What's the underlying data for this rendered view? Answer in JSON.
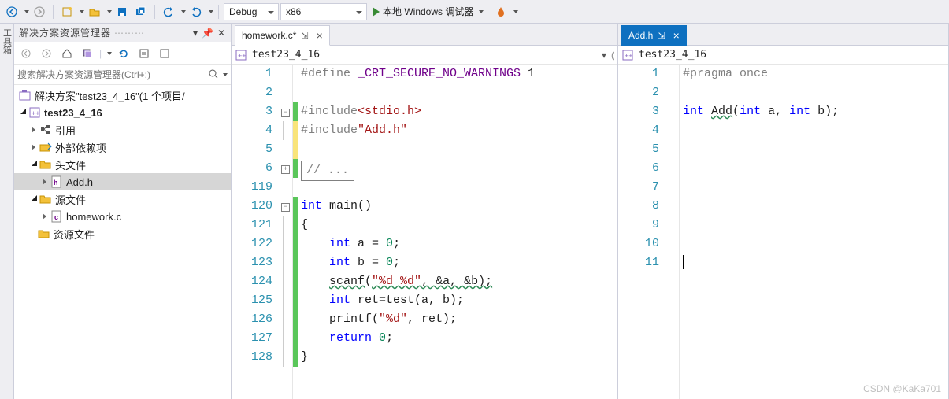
{
  "toolbar": {
    "config_label": "Debug",
    "platform_label": "x86",
    "run_label": "本地 Windows 调试器"
  },
  "solution_explorer": {
    "title": "解决方案资源管理器",
    "search_placeholder": "搜索解决方案资源管理器(Ctrl+;)",
    "solution_text": "解决方案\"test23_4_16\"(1 个项目/",
    "project": "test23_4_16",
    "refs": "引用",
    "ext_deps": "外部依赖项",
    "headers": "头文件",
    "header_file": "Add.h",
    "sources": "源文件",
    "source_file": "homework.c",
    "resources": "资源文件"
  },
  "left_editor": {
    "tab_label": "homework.c*",
    "breadcrumb": "test23_4_16",
    "code": {
      "l1_a": "#define ",
      "l1_b": "_CRT_SECURE_NO_WARNINGS",
      "l1_c": " 1",
      "l3_a": "#include",
      "l3_b": "<stdio.h>",
      "l4_a": "#include",
      "l4_b": "\"Add.h\"",
      "l6": "// ...",
      "l120_a": "int",
      "l120_b": " main()",
      "l121": "{",
      "l122_a": "int",
      "l122_b": " a = ",
      "l122_c": "0",
      "l122_d": ";",
      "l123_a": "int",
      "l123_b": " b = ",
      "l123_c": "0",
      "l123_d": ";",
      "l124_a": "scanf",
      "l124_b": "(",
      "l124_c": "\"%d %d\"",
      "l124_d": ", &a, &b);",
      "l125_a": "int",
      "l125_b": " ret=test(a, b);",
      "l126_a": "printf(",
      "l126_b": "\"%d\"",
      "l126_c": ", ret);",
      "l127_a": "return",
      "l127_b": " ",
      "l127_c": "0",
      "l127_d": ";",
      "l128": "}"
    },
    "line_numbers": [
      "1",
      "2",
      "3",
      "4",
      "5",
      "6",
      "119",
      "120",
      "121",
      "122",
      "123",
      "124",
      "125",
      "126",
      "127",
      "128"
    ]
  },
  "right_editor": {
    "tab_label": "Add.h",
    "breadcrumb": "test23_4_16",
    "code": {
      "l1": "#pragma once",
      "l3_a": "int",
      "l3_b": " ",
      "l3_c": "Add",
      "l3_d": "(",
      "l3_e": "int",
      "l3_f": " a, ",
      "l3_g": "int",
      "l3_h": " b);"
    },
    "line_numbers": [
      "1",
      "2",
      "3",
      "4",
      "5",
      "6",
      "7",
      "8",
      "9",
      "10",
      "11"
    ]
  },
  "watermark": "CSDN @KaKa701",
  "left_strip_label": "工具箱"
}
